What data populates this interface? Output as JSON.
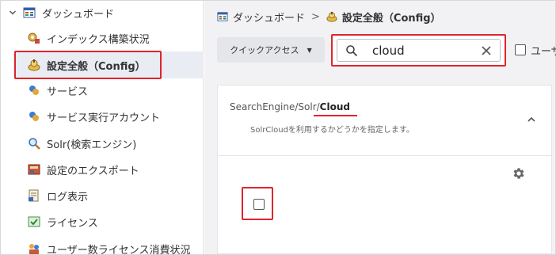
{
  "sidebar": {
    "root": {
      "label": "ダッシュボード",
      "icon": "dashboard-icon"
    },
    "items": [
      {
        "label": "インデックス構築状況",
        "icon": "index-build-icon"
      },
      {
        "label": "設定全般（Config）",
        "icon": "config-icon",
        "selected": true
      },
      {
        "label": "サービス",
        "icon": "service-icon"
      },
      {
        "label": "サービス実行アカウント",
        "icon": "service-account-icon"
      },
      {
        "label": "Solr(検索エンジン)",
        "icon": "search-engine-icon"
      },
      {
        "label": "設定のエクスポート",
        "icon": "export-icon"
      },
      {
        "label": "ログ表示",
        "icon": "log-icon"
      },
      {
        "label": "ライセンス",
        "icon": "license-icon"
      },
      {
        "label": "ユーザー数ライセンス消費状況",
        "icon": "user-license-icon"
      }
    ]
  },
  "breadcrumb": {
    "home": "ダッシュボード",
    "separator": ">",
    "current": "設定全般（Config）"
  },
  "toolbar": {
    "quick_access_label": "クイックアクセス",
    "search_value": "cloud",
    "user_checkbox_label": "ユーザー"
  },
  "setting": {
    "path_prefix": "SearchEngine/Solr/",
    "path_key": "Cloud",
    "description": "SolrCloudを利用するかどうかを指定します。",
    "value_checked": false
  },
  "colors": {
    "highlight": "#e0242b",
    "selected_bg": "#e9ecf2",
    "main_bg": "#f2f2f4"
  }
}
